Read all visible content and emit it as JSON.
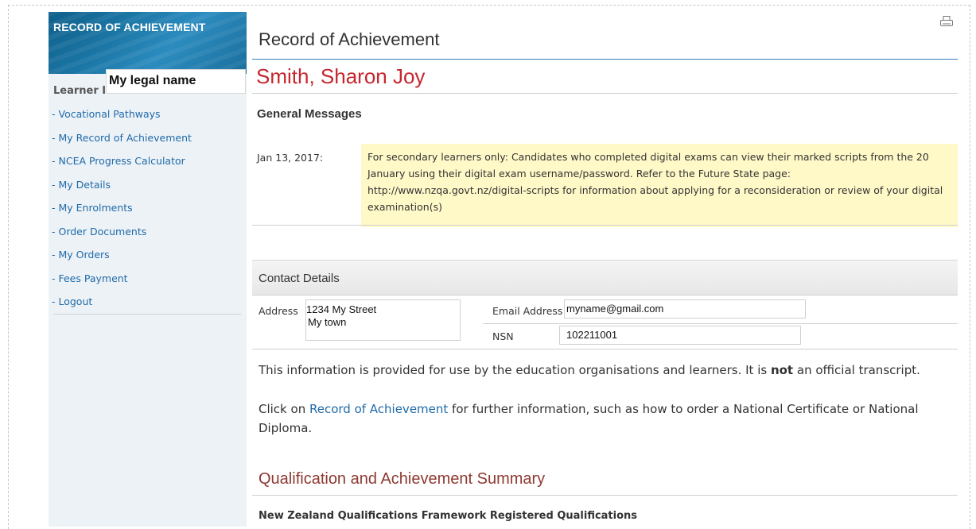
{
  "sidebar": {
    "header_title": "RECORD OF ACHIEVEMENT",
    "learner_label": "Learner I",
    "legal_name_overlay": "My legal name",
    "items": [
      {
        "label": "- Vocational Pathways"
      },
      {
        "label": "- My Record of Achievement"
      },
      {
        "label": "- NCEA Progress Calculator"
      },
      {
        "label": "- My Details"
      },
      {
        "label": "- My Enrolments"
      },
      {
        "label": "- Order Documents"
      },
      {
        "label": "- My Orders"
      },
      {
        "label": "- Fees Payment"
      },
      {
        "label": "- Logout"
      }
    ]
  },
  "main": {
    "page_title": "Record of Achievement",
    "print_icon": "printer-icon",
    "learner_name": "Smith, Sharon Joy",
    "general_messages": {
      "title": "General Messages",
      "date": "Jan 13, 2017:",
      "message": "For secondary learners only: Candidates who completed digital exams can view their marked scripts from the 20 January using their digital exam username/password. Refer to the Future State page: http://www.nzqa.govt.nz/digital-scripts for information about applying for a reconsideration or review of your digital examination(s)"
    },
    "contact": {
      "title": "Contact Details",
      "address_label": "Address",
      "address_line1": "1234 My Street",
      "address_line2": "My town",
      "email_label": "Email Address",
      "email_value": "myname@gmail.com",
      "nsn_label": "NSN",
      "nsn_value": "102211001"
    },
    "info_text_pre": "This information is provided for use by the education organisations and learners. It is ",
    "info_text_bold": "not",
    "info_text_post": " an official transcript.",
    "click_text_pre": "Click on ",
    "click_link": "Record of Achievement",
    "click_text_post": " for further information, such as how to order a National Certificate or National Diploma.",
    "qualification_title": "Qualification and Achievement Summary",
    "qualification_subtitle": "New Zealand Qualifications Framework Registered Qualifications"
  },
  "colors": {
    "accent_blue": "#1f6aa8",
    "name_red": "#c6262e",
    "message_bg": "#fff9c8",
    "section_title": "#8e3a32"
  }
}
